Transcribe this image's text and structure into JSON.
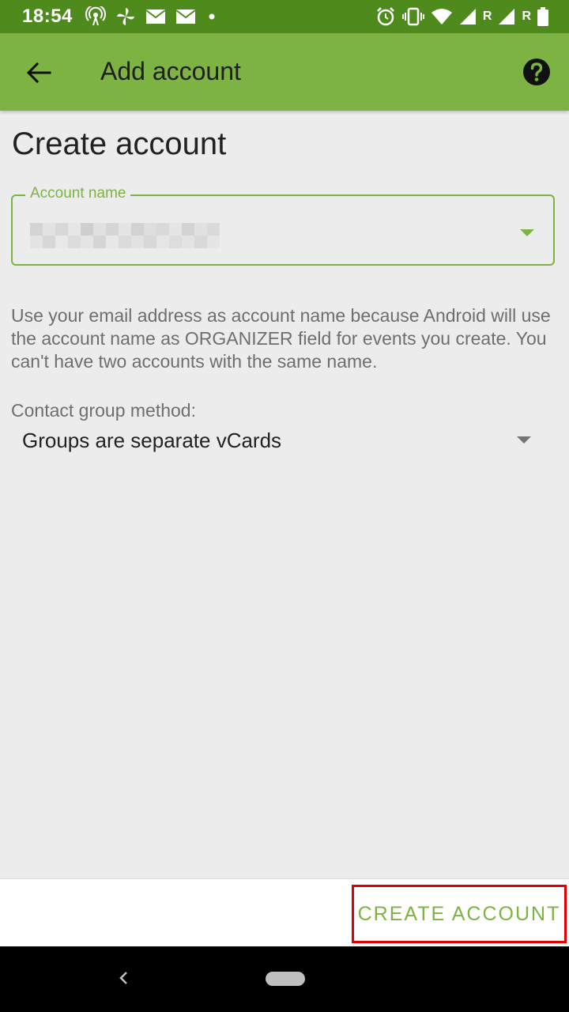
{
  "status_bar": {
    "time": "18:54",
    "left_icons": [
      "hotspot-icon",
      "pinwheel-icon",
      "mail-icon",
      "mail-icon",
      "dot-icon"
    ],
    "right_icons": [
      "alarm-icon",
      "vibrate-icon",
      "wifi-icon",
      "signal-icon",
      "signal-icon",
      "battery-icon"
    ],
    "roaming_1": "R",
    "roaming_2": "R"
  },
  "app_bar": {
    "title": "Add account",
    "back_icon": "arrow-left-icon",
    "help_icon": "help-circle-icon",
    "color": "#7cb342"
  },
  "form": {
    "heading": "Create account",
    "account_name": {
      "label": "Account name",
      "value_obscured": true
    },
    "help_text": "Use your email address as account name because Android will use the account name as ORGANIZER field for events you create. You can't have two accounts with the same name.",
    "contact_group": {
      "label": "Contact group method:",
      "selected": "Groups are separate vCards"
    }
  },
  "actions": {
    "create_account": "CREATE ACCOUNT",
    "highlight_color": "#e00000"
  },
  "nav_bar": {
    "back_icon": "nav-back-icon",
    "home_icon": "nav-home-pill-icon"
  }
}
